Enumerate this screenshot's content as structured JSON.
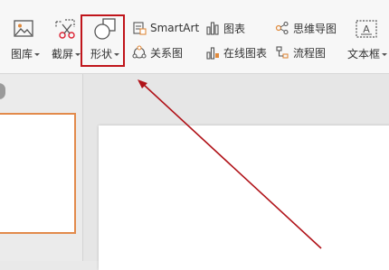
{
  "ribbon": {
    "picture_lib": {
      "label": "图库",
      "icon": "picture-icon"
    },
    "screenshot": {
      "label": "截屏",
      "icon": "scissors-icon"
    },
    "shapes": {
      "label": "形状",
      "icon": "shapes-icon"
    },
    "smartart": {
      "label": "SmartArt",
      "icon": "smartart-icon"
    },
    "relation": {
      "label": "关系图",
      "icon": "relation-icon"
    },
    "chart": {
      "label": "图表",
      "icon": "chart-icon"
    },
    "online_chart": {
      "label": "在线图表",
      "icon": "online-chart-icon"
    },
    "mindmap": {
      "label": "思维导图",
      "icon": "mindmap-icon"
    },
    "flowchart": {
      "label": "流程图",
      "icon": "flowchart-icon"
    },
    "textbox": {
      "label": "文本框",
      "icon": "textbox-icon"
    }
  },
  "annotation": {
    "highlight_color": "#c0151b",
    "arrow_color": "#b01218"
  },
  "colors": {
    "thumb_border": "#e28a4b"
  }
}
